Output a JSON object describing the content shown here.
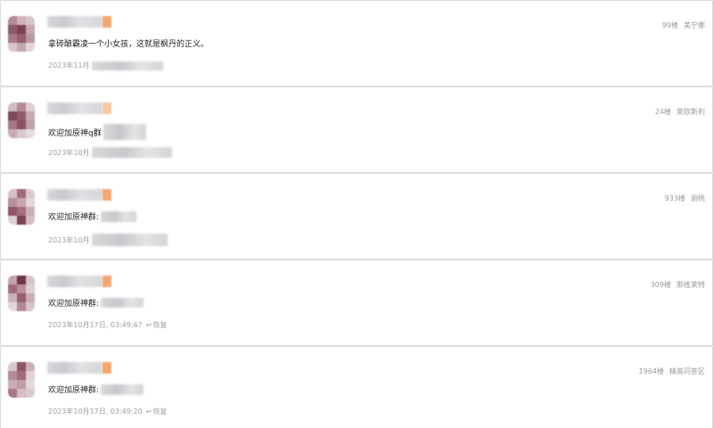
{
  "comments": [
    {
      "floor": "99楼",
      "location": "美宁娜",
      "text": "拿砖酿霸凌一个小女孩，这就是枫丹的正义。",
      "date": "2023年11月",
      "reply_label": ""
    },
    {
      "floor": "24楼",
      "location": "莱欧斯利",
      "text": "欢迎加原神q群",
      "date": "2023年10月",
      "reply_label": ""
    },
    {
      "floor": "933楼",
      "location": "胡桃",
      "text": "欢迎加原神群:",
      "date": "2023年10月",
      "reply_label": ""
    },
    {
      "floor": "309楼",
      "location": "那维莱特",
      "text": "欢迎加原神群:",
      "date": "2023年10月17日, 03:49:47",
      "reply_label": "恢复"
    },
    {
      "floor": "1964楼",
      "location": "精英问答区",
      "text": "欢迎加原神群:",
      "date": "2023年10月17日, 03:49:20",
      "reply_label": "恢复"
    }
  ],
  "icons": {
    "reply": "reply-arrow-icon"
  }
}
